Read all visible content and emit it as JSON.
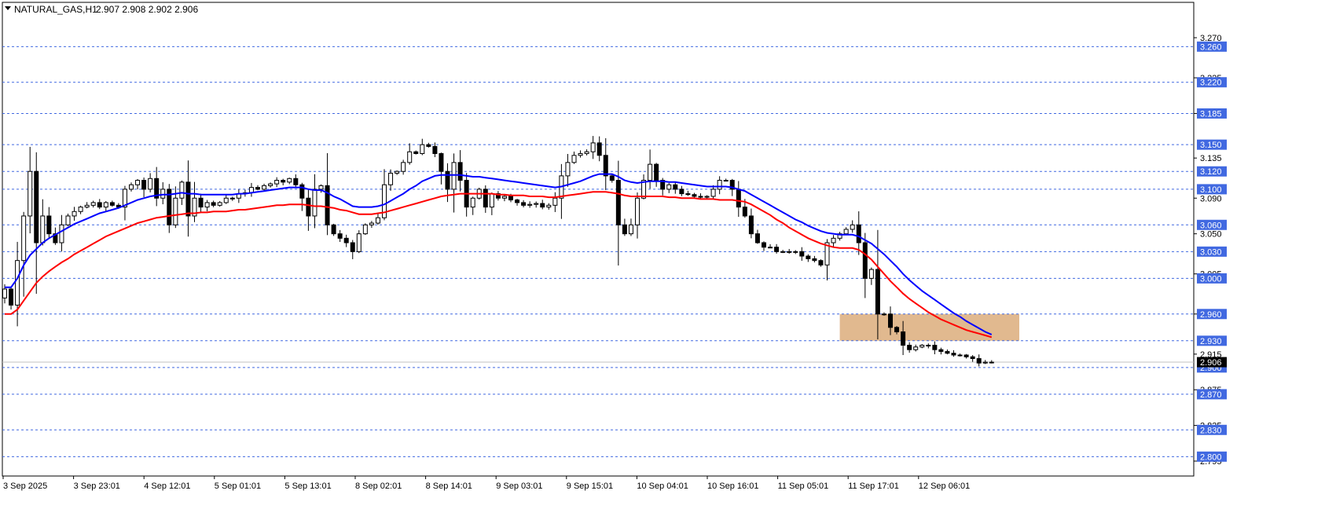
{
  "header": {
    "symbol_tf": "NATURAL_GAS,H1",
    "ohlc": "2.907 2.908 2.902 2.906",
    "menu_icon": "triangle-down-icon"
  },
  "chart_data": {
    "type": "candlestick",
    "symbol": "NATURAL_GAS",
    "timeframe": "H1",
    "ylim": [
      2.79,
      3.285
    ],
    "y_ticks": [
      "3.270",
      "3.225",
      "3.185",
      "3.135",
      "3.090",
      "3.050",
      "3.005",
      "2.960",
      "2.915",
      "2.875",
      "2.835",
      "2.795"
    ],
    "x_labels": [
      "3 Sep 2025",
      "3 Sep 23:01",
      "4 Sep 12:01",
      "5 Sep 01:01",
      "5 Sep 13:01",
      "8 Sep 02:01",
      "8 Sep 14:01",
      "9 Sep 03:01",
      "9 Sep 15:01",
      "10 Sep 04:01",
      "10 Sep 16:01",
      "11 Sep 05:01",
      "11 Sep 17:01",
      "12 Sep 06:01"
    ],
    "levels": [
      3.26,
      3.22,
      3.185,
      3.15,
      3.12,
      3.1,
      3.06,
      3.03,
      3.0,
      2.96,
      2.93,
      2.9,
      2.87,
      2.83,
      2.8
    ],
    "level_labels": [
      "3.260",
      "3.220",
      "3.185",
      "3.150",
      "3.120",
      "3.100",
      "3.060",
      "3.030",
      "3.000",
      "2.960",
      "2.930",
      "2.900",
      "2.870",
      "2.830",
      "2.800"
    ],
    "current_price": 2.906,
    "current_price_label": "2.906",
    "zone": {
      "from": 2.93,
      "to": 2.96,
      "color": "#deb183"
    },
    "colors": {
      "bull": "#ffffff",
      "bear": "#000000",
      "ma_fast": "#0000ff",
      "ma_slow": "#ff0000",
      "level_line": "#4169e1",
      "level_label_bg": "#4169e1"
    },
    "closes": [
      2.988,
      2.97,
      3.02,
      3.07,
      3.12,
      3.04,
      3.07,
      3.05,
      3.04,
      3.06,
      3.07,
      3.075,
      3.08,
      3.082,
      3.085,
      3.08,
      3.085,
      3.082,
      3.08,
      3.1,
      3.105,
      3.11,
      3.1,
      3.112,
      3.09,
      3.1,
      3.06,
      3.09,
      3.108,
      3.07,
      3.09,
      3.08,
      3.085,
      3.082,
      3.085,
      3.09,
      3.09,
      3.095,
      3.096,
      3.102,
      3.1,
      3.104,
      3.106,
      3.11,
      3.108,
      3.112,
      3.105,
      3.09,
      3.07,
      3.1,
      3.104,
      3.06,
      3.05,
      3.045,
      3.04,
      3.03,
      3.05,
      3.06,
      3.062,
      3.068,
      3.105,
      3.118,
      3.12,
      3.13,
      3.142,
      3.14,
      3.15,
      3.148,
      3.14,
      3.12,
      3.1,
      3.13,
      3.11,
      3.08,
      3.09,
      3.1,
      3.08,
      3.095,
      3.09,
      3.092,
      3.088,
      3.085,
      3.082,
      3.083,
      3.084,
      3.08,
      3.082,
      3.09,
      3.115,
      3.13,
      3.138,
      3.14,
      3.142,
      3.152,
      3.138,
      3.115,
      3.11,
      3.06,
      3.05,
      3.06,
      3.09,
      3.11,
      3.128,
      3.11,
      3.1,
      3.105,
      3.1,
      3.095,
      3.094,
      3.092,
      3.091,
      3.092,
      3.1,
      3.11,
      3.11,
      3.1,
      3.08,
      3.07,
      3.05,
      3.04,
      3.035,
      3.035,
      3.03,
      3.03,
      3.03,
      3.03,
      3.025,
      3.022,
      3.02,
      3.015,
      3.04,
      3.045,
      3.05,
      3.055,
      3.06,
      3.04,
      3.0,
      3.01,
      2.96,
      2.96,
      2.945,
      2.94,
      2.925,
      2.92,
      2.923,
      2.925,
      2.925,
      2.92,
      2.918,
      2.916,
      2.914,
      2.914,
      2.912,
      2.91,
      2.905,
      2.906,
      2.906
    ],
    "ma_fast": [
      2.99,
      2.99,
      3.0,
      3.015,
      3.026,
      3.033,
      3.04,
      3.045,
      3.049,
      3.053,
      3.057,
      3.061,
      3.064,
      3.067,
      3.07,
      3.073,
      3.075,
      3.077,
      3.079,
      3.082,
      3.085,
      3.088,
      3.09,
      3.092,
      3.093,
      3.094,
      3.094,
      3.095,
      3.096,
      3.095,
      3.095,
      3.094,
      3.094,
      3.094,
      3.094,
      3.094,
      3.094,
      3.095,
      3.095,
      3.096,
      3.097,
      3.098,
      3.099,
      3.1,
      3.101,
      3.102,
      3.102,
      3.102,
      3.1,
      3.099,
      3.099,
      3.096,
      3.092,
      3.089,
      3.085,
      3.081,
      3.08,
      3.08,
      3.08,
      3.081,
      3.083,
      3.087,
      3.091,
      3.095,
      3.1,
      3.104,
      3.109,
      3.112,
      3.115,
      3.116,
      3.116,
      3.116,
      3.116,
      3.115,
      3.114,
      3.114,
      3.113,
      3.112,
      3.111,
      3.11,
      3.109,
      3.108,
      3.107,
      3.106,
      3.105,
      3.104,
      3.103,
      3.102,
      3.103,
      3.105,
      3.107,
      3.109,
      3.112,
      3.115,
      3.117,
      3.117,
      3.117,
      3.114,
      3.11,
      3.108,
      3.107,
      3.108,
      3.109,
      3.109,
      3.109,
      3.108,
      3.108,
      3.107,
      3.106,
      3.105,
      3.104,
      3.103,
      3.103,
      3.103,
      3.103,
      3.102,
      3.1,
      3.098,
      3.094,
      3.09,
      3.086,
      3.082,
      3.078,
      3.074,
      3.07,
      3.066,
      3.063,
      3.059,
      3.056,
      3.053,
      3.051,
      3.05,
      3.049,
      3.049,
      3.049,
      3.047,
      3.043,
      3.039,
      3.033,
      3.027,
      3.02,
      3.013,
      3.005,
      2.998,
      2.992,
      2.986,
      2.981,
      2.976,
      2.971,
      2.966,
      2.961,
      2.957,
      2.952,
      2.948,
      2.944,
      2.94,
      2.937
    ],
    "ma_slow": [
      2.96,
      2.96,
      2.965,
      2.975,
      2.985,
      2.995,
      3.002,
      3.008,
      3.013,
      3.018,
      3.022,
      3.027,
      3.031,
      3.035,
      3.039,
      3.043,
      3.047,
      3.05,
      3.053,
      3.056,
      3.059,
      3.062,
      3.064,
      3.066,
      3.068,
      3.069,
      3.07,
      3.071,
      3.072,
      3.073,
      3.073,
      3.074,
      3.074,
      3.075,
      3.075,
      3.075,
      3.076,
      3.077,
      3.077,
      3.078,
      3.079,
      3.08,
      3.081,
      3.082,
      3.082,
      3.083,
      3.083,
      3.083,
      3.082,
      3.081,
      3.081,
      3.08,
      3.079,
      3.077,
      3.076,
      3.074,
      3.072,
      3.072,
      3.072,
      3.073,
      3.074,
      3.076,
      3.078,
      3.08,
      3.082,
      3.084,
      3.086,
      3.088,
      3.09,
      3.092,
      3.093,
      3.094,
      3.095,
      3.095,
      3.095,
      3.095,
      3.095,
      3.095,
      3.094,
      3.094,
      3.093,
      3.093,
      3.093,
      3.092,
      3.092,
      3.092,
      3.091,
      3.091,
      3.092,
      3.093,
      3.094,
      3.095,
      3.096,
      3.097,
      3.097,
      3.097,
      3.096,
      3.095,
      3.093,
      3.092,
      3.092,
      3.092,
      3.092,
      3.092,
      3.092,
      3.091,
      3.091,
      3.09,
      3.09,
      3.09,
      3.089,
      3.089,
      3.089,
      3.088,
      3.088,
      3.088,
      3.087,
      3.086,
      3.083,
      3.079,
      3.075,
      3.071,
      3.066,
      3.062,
      3.057,
      3.053,
      3.049,
      3.045,
      3.042,
      3.039,
      3.037,
      3.035,
      3.034,
      3.034,
      3.034,
      3.032,
      3.027,
      3.021,
      3.013,
      3.005,
      2.997,
      2.99,
      2.983,
      2.977,
      2.972,
      2.967,
      2.962,
      2.958,
      2.954,
      2.951,
      2.948,
      2.945,
      2.942,
      2.94,
      2.938,
      2.936,
      2.934
    ]
  }
}
